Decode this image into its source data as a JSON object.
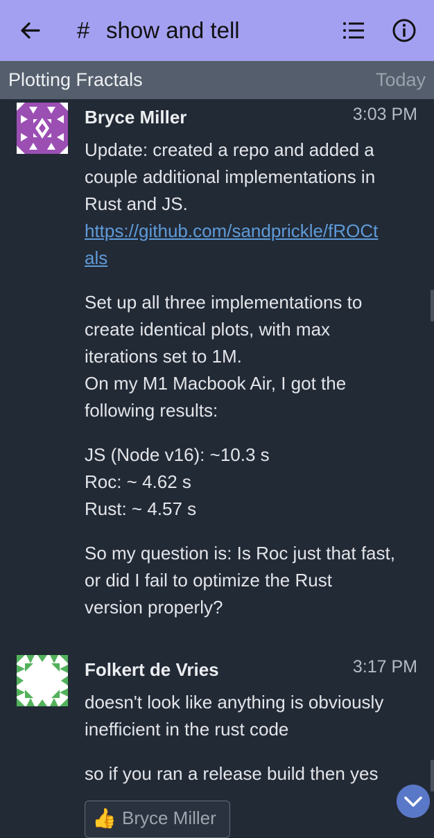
{
  "header": {
    "hash": "#",
    "stream": "show and tell",
    "icons": [
      "back-arrow-icon",
      "list-icon",
      "info-icon"
    ]
  },
  "topic_bar": {
    "topic": "Plotting Fractals",
    "date": "Today"
  },
  "messages": [
    {
      "sender": "Bryce Miller",
      "time": "3:03 PM",
      "lines": [
        "Update: created a repo and added a",
        "couple additional implementations in",
        "Rust and JS.",
        "https://github.com/sandprickle/fROCt",
        "als",
        "Set up all three implementations to",
        "create identical plots, with max",
        "iterations set to 1M.",
        "On my M1 Macbook Air, I got the",
        "following results:",
        "JS (Node v16): ~10.3 s",
        "Roc: ~ 4.62 s",
        "Rust: ~ 4.57 s",
        "So my question is: Is Roc just that fast,",
        "or did I fail to optimize the Rust",
        "version properly?"
      ],
      "avatar_color": "#9b4fb3"
    },
    {
      "sender": "Folkert de Vries",
      "time": "3:17 PM",
      "lines": [
        "doesn't look like anything is obviously",
        "inefficient in the rust code",
        "so if you ran a release build then yes"
      ],
      "avatar_color": "#52b25c",
      "reaction": {
        "emoji": "👍",
        "user": "Bryce Miller"
      }
    }
  ],
  "colors": {
    "header_bg": "#a4a0f1",
    "topic_bg": "#545e6c",
    "body_bg": "#222a36",
    "link": "#5f9bd9"
  }
}
